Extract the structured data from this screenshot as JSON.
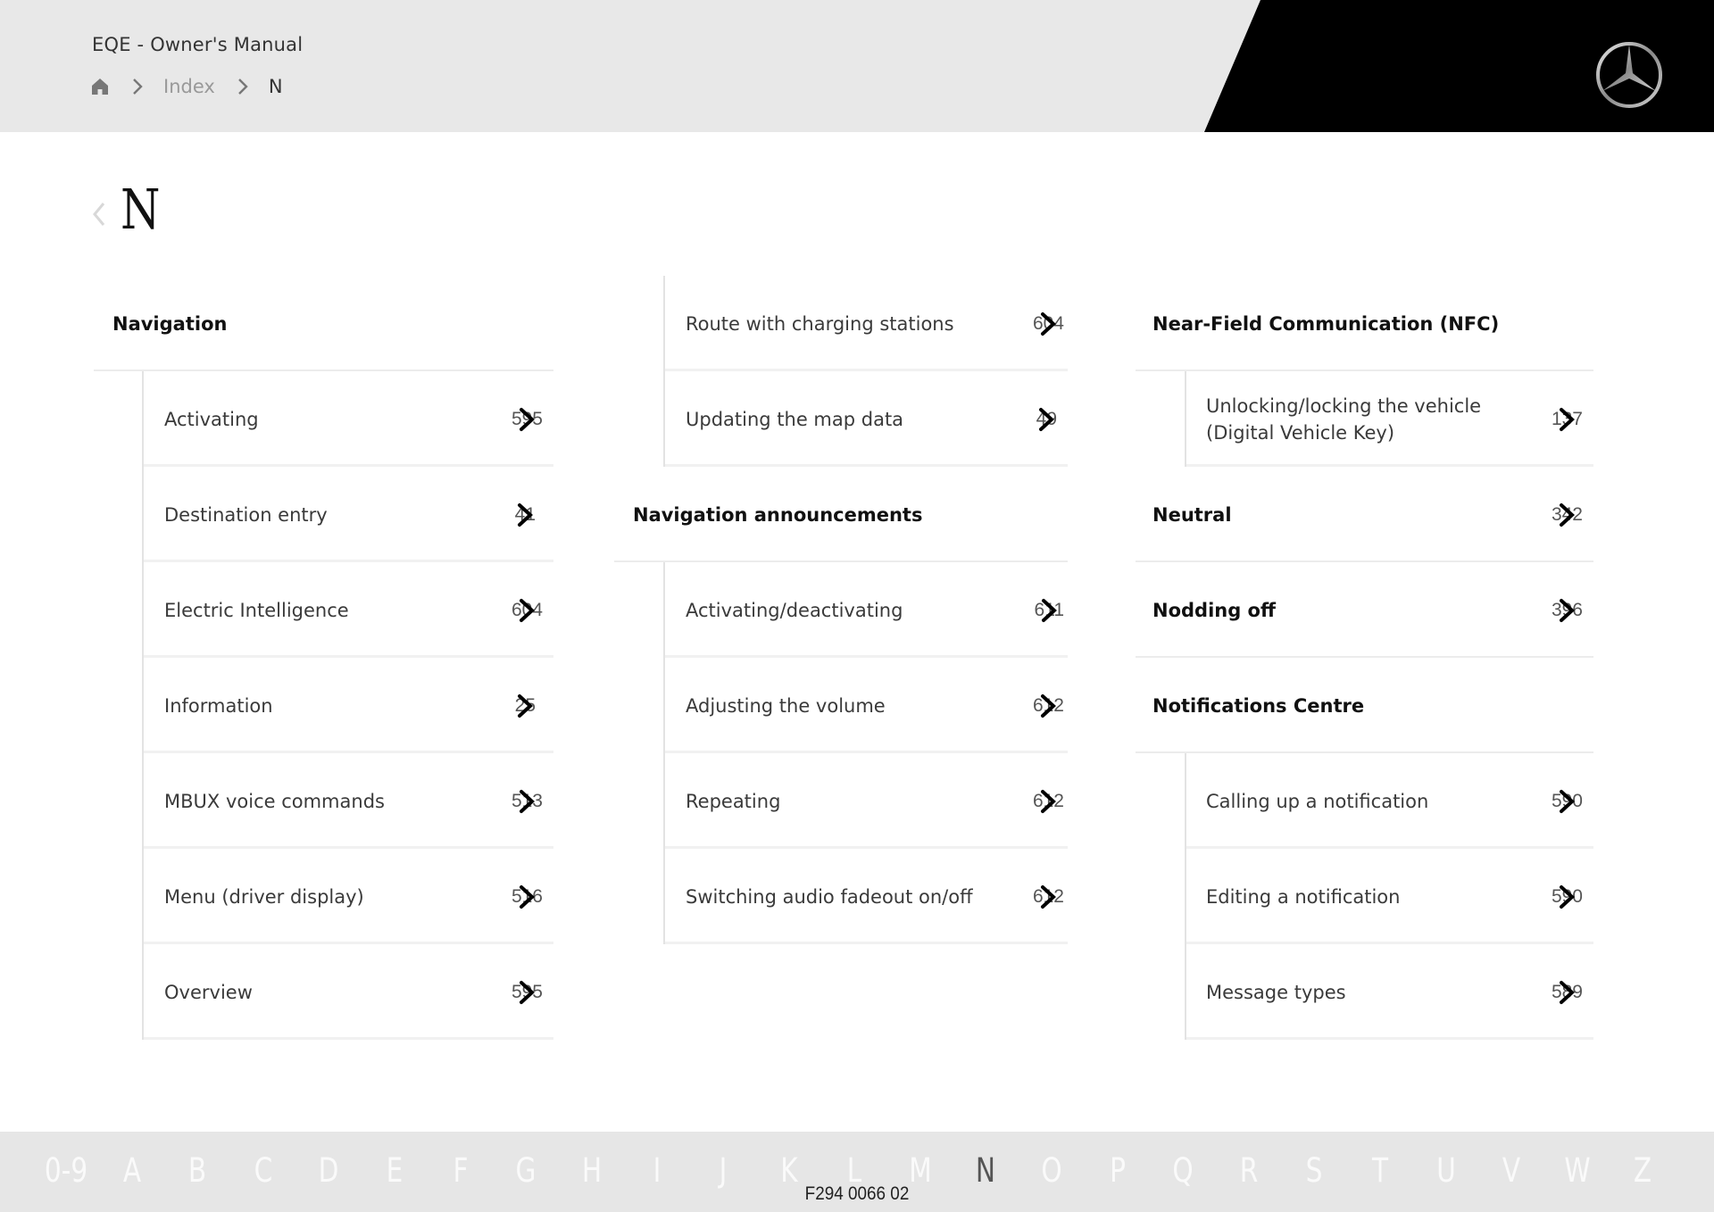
{
  "header": {
    "manual_title": "EQE - Owner's Manual",
    "breadcrumb": {
      "home_icon": "home-icon",
      "separator_icon": "chevron-right-icon",
      "items": [
        "Index",
        "N"
      ]
    },
    "logo": "mercedes-benz-star-logo"
  },
  "page": {
    "back_icon": "chevron-left-icon",
    "letter": "N"
  },
  "columns": [
    {
      "groups": [
        {
          "heading": "Navigation",
          "page": "",
          "items": [
            {
              "label": "Activating",
              "page": "595"
            },
            {
              "label": "Destination entry",
              "page": "41"
            },
            {
              "label": "Electric Intelligence",
              "page": "604"
            },
            {
              "label": "Information",
              "page": "25"
            },
            {
              "label": "MBUX voice commands",
              "page": "513"
            },
            {
              "label": "Menu (driver display)",
              "page": "516"
            },
            {
              "label": "Overview",
              "page": "595"
            }
          ]
        }
      ]
    },
    {
      "groups": [
        {
          "heading": "",
          "page": "",
          "items": [
            {
              "label": "Route with charging stations",
              "page": "604"
            },
            {
              "label": "Updating the map data",
              "page": "49"
            }
          ]
        },
        {
          "heading": "Navigation announcements",
          "page": "",
          "items": [
            {
              "label": "Activating/deactivating",
              "page": "611"
            },
            {
              "label": "Adjusting the volume",
              "page": "612"
            },
            {
              "label": "Repeating",
              "page": "612"
            },
            {
              "label": "Switching audio fadeout on/off",
              "page": "612"
            }
          ]
        }
      ]
    },
    {
      "groups": [
        {
          "heading": "Near-Field Communication (NFC)",
          "page": "",
          "items": [
            {
              "label": "Unlocking/locking the vehicle (Digital Vehicle Key)",
              "page": "137"
            }
          ]
        },
        {
          "heading": "Neutral",
          "page": "342",
          "items": []
        },
        {
          "heading": "Nodding off",
          "page": "396",
          "items": []
        },
        {
          "heading": "Notifications Centre",
          "page": "",
          "items": [
            {
              "label": "Calling up a notification",
              "page": "590"
            },
            {
              "label": "Editing a notification",
              "page": "590"
            },
            {
              "label": "Message types",
              "page": "589"
            }
          ]
        }
      ]
    }
  ],
  "page_link_icon": "chevron-right-icon",
  "alphabet": {
    "letters": [
      "0-9",
      "A",
      "B",
      "C",
      "D",
      "E",
      "F",
      "G",
      "H",
      "I",
      "J",
      "K",
      "L",
      "M",
      "N",
      "O",
      "P",
      "Q",
      "R",
      "S",
      "T",
      "U",
      "V",
      "W",
      "Z"
    ],
    "active": "N"
  },
  "doc_code": "F294 0066 02"
}
